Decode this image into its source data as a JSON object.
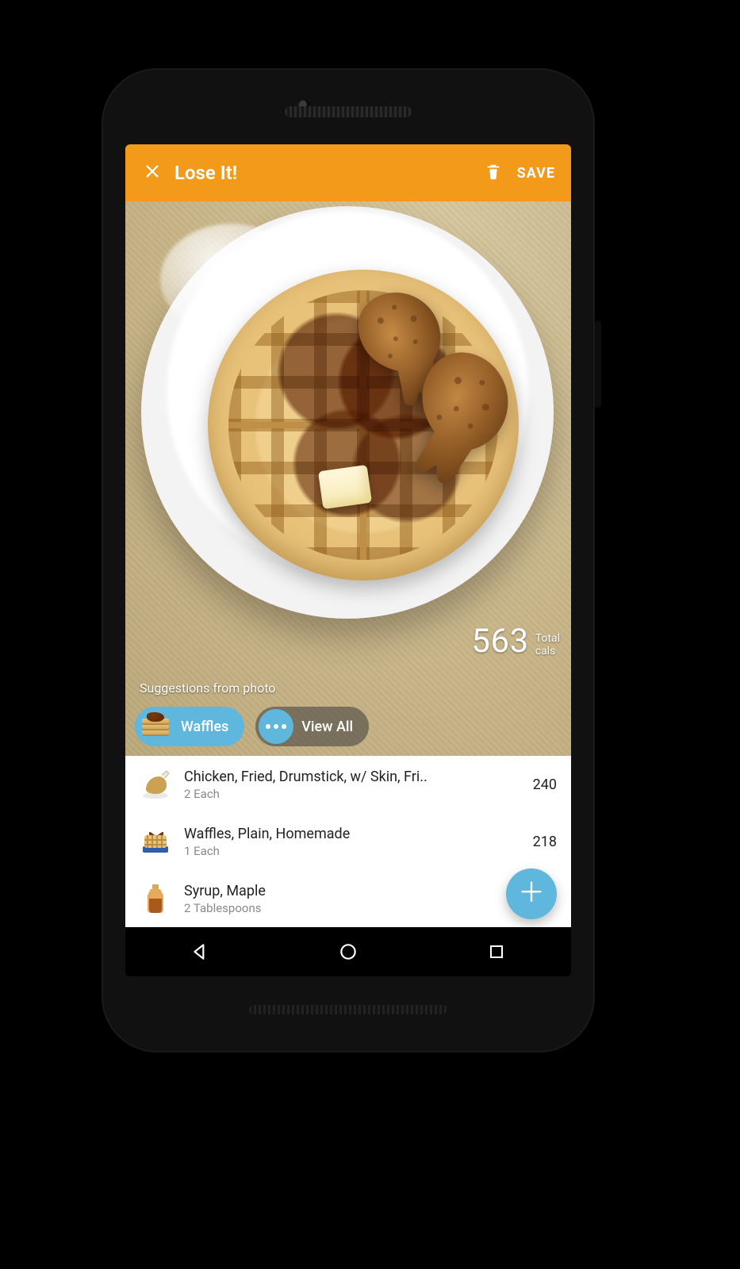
{
  "colors": {
    "accent": "#f39a1a",
    "chip": "#5fb7dd"
  },
  "appbar": {
    "title": "Lose It!",
    "save_label": "SAVE"
  },
  "photo": {
    "suggestions_label": "Suggestions from photo",
    "total_calories": "563",
    "total_label_line1": "Total",
    "total_label_line2": "cals",
    "chips": [
      {
        "label": "Waffles",
        "icon": "waffle-stack-icon"
      },
      {
        "label": "View All",
        "icon": "more-icon"
      }
    ]
  },
  "list": {
    "items": [
      {
        "name": "Chicken, Fried, Drumstick, w/ Skin, Fri..",
        "serving": "2 Each",
        "calories": "240",
        "icon": "chicken-icon"
      },
      {
        "name": "Waffles, Plain, Homemade",
        "serving": "1 Each",
        "calories": "218",
        "icon": "waffle-icon"
      },
      {
        "name": "Syrup, Maple",
        "serving": "2 Tablespoons",
        "calories": "",
        "icon": "syrup-icon"
      }
    ]
  }
}
